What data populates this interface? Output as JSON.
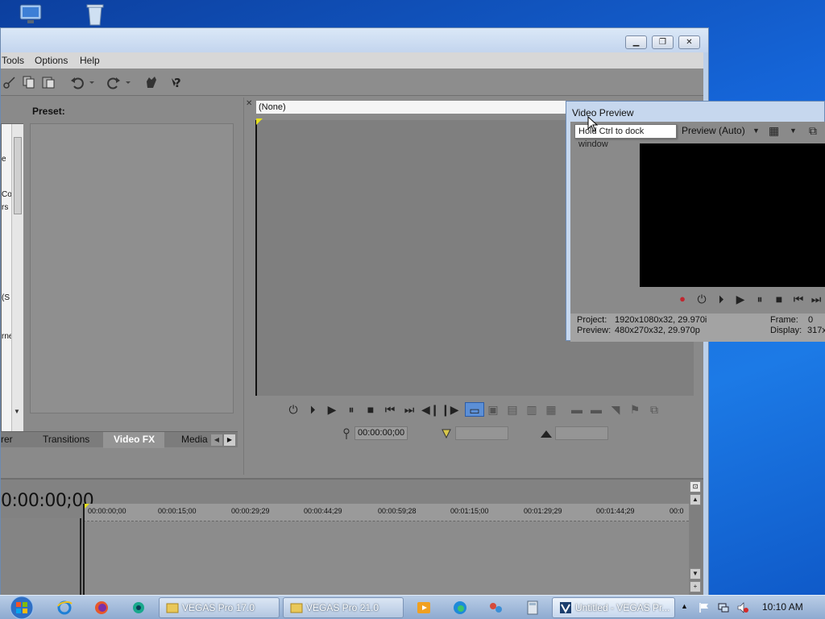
{
  "desktop": {
    "icons": [
      "computer-icon",
      "recycle-bin-icon"
    ]
  },
  "main_window": {
    "menu": [
      "Tools",
      "Options",
      "Help"
    ],
    "explorer": {
      "list_fragments": [
        "e",
        "Co",
        "rs",
        "(S",
        "rne"
      ],
      "preset_label": "Preset:",
      "tabs": [
        "rer",
        "Transitions",
        "Video FX",
        "Media"
      ]
    },
    "trimmer": {
      "dropdown_value": "(None)",
      "timecode": "00:00:00;00"
    },
    "timeline": {
      "big_timecode": "0:00:00;00",
      "ruler_ticks": [
        "00:00:00;00",
        "00:00:15;00",
        "00:00:29;29",
        "00:00:44;29",
        "00:00:59;28",
        "00:01:15;00",
        "00:01:29;29",
        "00:01:44;29",
        "00:0"
      ]
    }
  },
  "video_preview": {
    "title": "Video Preview",
    "quality": "Preview (Auto)",
    "tooltip": "Hold Ctrl to dock window",
    "info": {
      "project_label": "Project:",
      "project_value": "1920x1080x32, 29.970i",
      "preview_label": "Preview:",
      "preview_value": "480x270x32, 29.970p",
      "frame_label": "Frame:",
      "frame_value": "0",
      "display_label": "Display:",
      "display_value": "317x"
    }
  },
  "taskbar": {
    "buttons": [
      "VEGAS Pro 17.0",
      "VEGAS Pro 21.0",
      "Untitled - VEGAS Pr..."
    ],
    "clock": "10:10 AM"
  },
  "colors": {
    "desktop": "#1565d8",
    "app_panel": "#8a8a8a",
    "preview_screen": "#000000",
    "record_button": "#c0262f"
  }
}
